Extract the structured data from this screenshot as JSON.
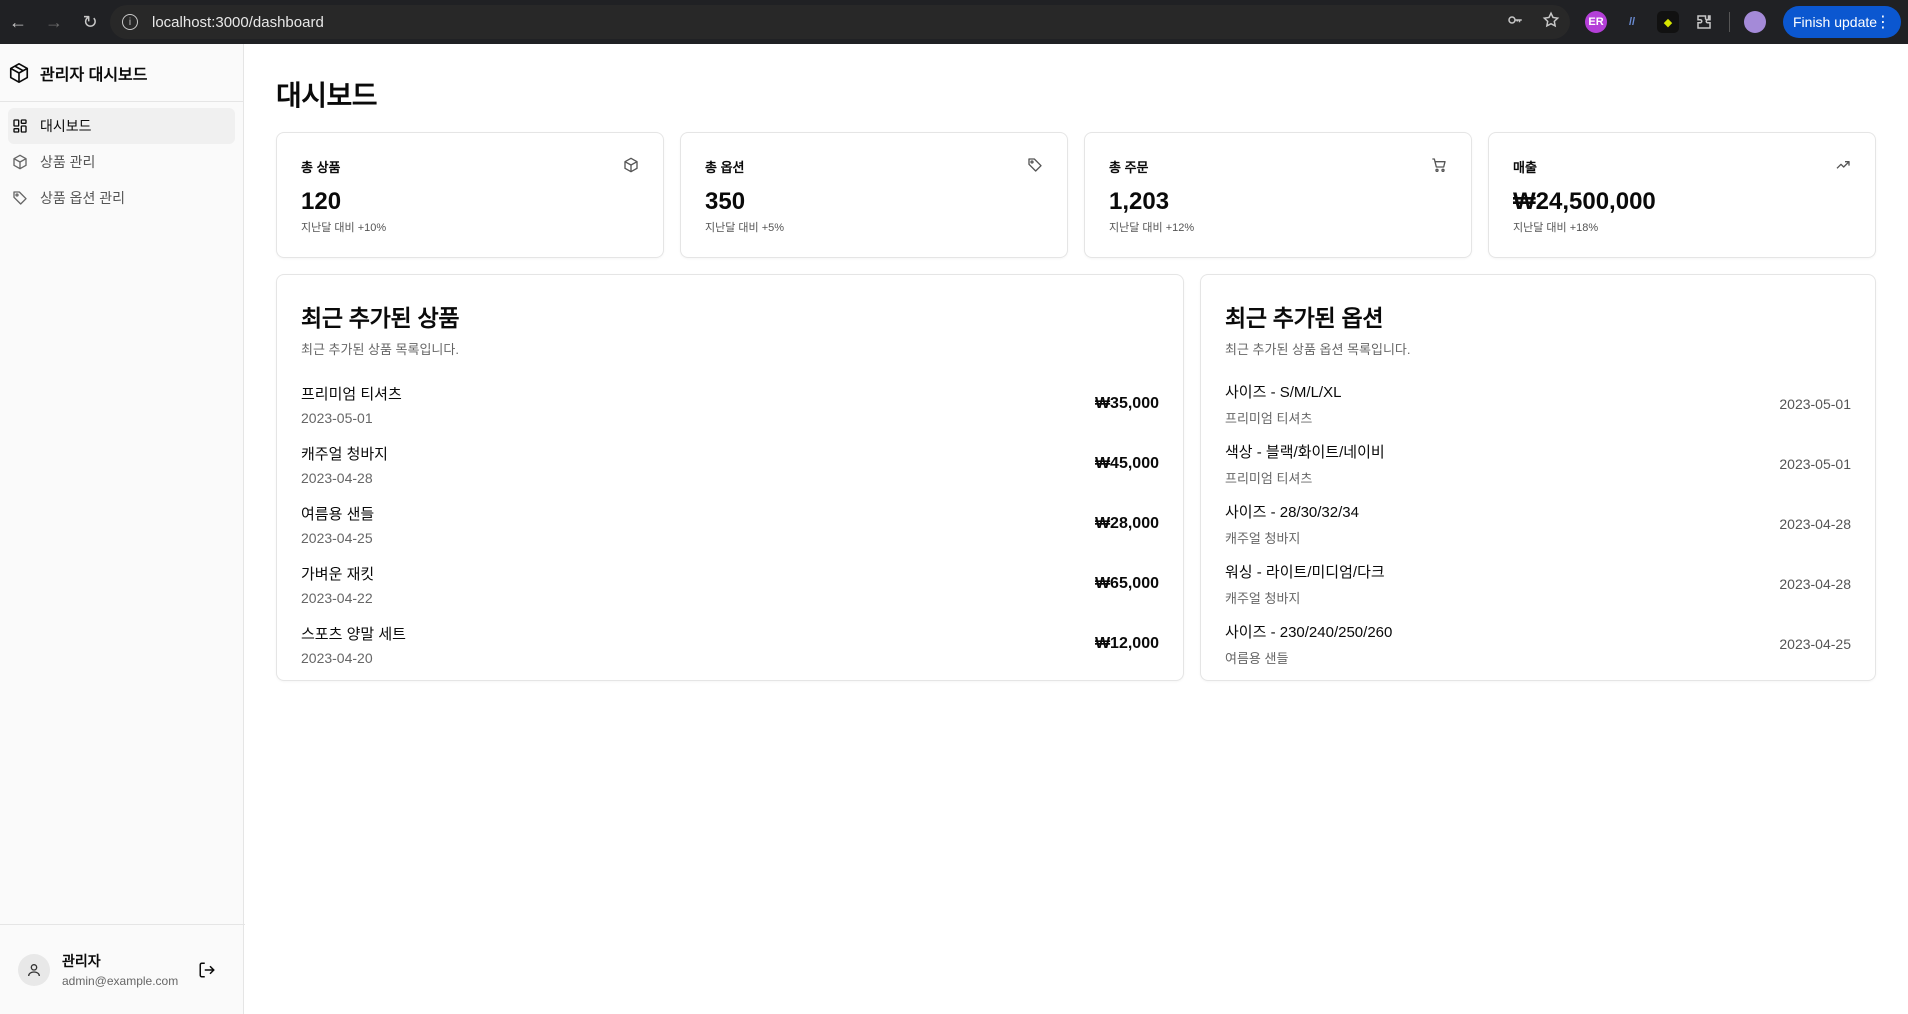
{
  "browser": {
    "url": "localhost:3000/dashboard",
    "finish_update": "Finish update"
  },
  "sidebar": {
    "brand": "관리자 대시보드",
    "items": [
      {
        "label": "대시보드",
        "icon": "grid-icon",
        "active": true
      },
      {
        "label": "상품 관리",
        "icon": "package-icon",
        "active": false
      },
      {
        "label": "상품 옵션 관리",
        "icon": "tag-icon",
        "active": false
      }
    ],
    "user": {
      "name": "관리자",
      "email": "admin@example.com"
    }
  },
  "main": {
    "title": "대시보드",
    "stats": [
      {
        "label": "총 상품",
        "value": "120",
        "change": "지난달 대비 +10%",
        "icon": "package-icon"
      },
      {
        "label": "총 옵션",
        "value": "350",
        "change": "지난달 대비 +5%",
        "icon": "tag-icon"
      },
      {
        "label": "총 주문",
        "value": "1,203",
        "change": "지난달 대비 +12%",
        "icon": "cart-icon"
      },
      {
        "label": "매출",
        "value": "₩24,500,000",
        "change": "지난달 대비 +18%",
        "icon": "trending-up-icon"
      }
    ],
    "recent_products": {
      "title": "최근 추가된 상품",
      "description": "최근 추가된 상품 목록입니다.",
      "items": [
        {
          "name": "프리미엄 티셔츠",
          "date": "2023-05-01",
          "price": "₩35,000"
        },
        {
          "name": "캐주얼 청바지",
          "date": "2023-04-28",
          "price": "₩45,000"
        },
        {
          "name": "여름용 샌들",
          "date": "2023-04-25",
          "price": "₩28,000"
        },
        {
          "name": "가벼운 재킷",
          "date": "2023-04-22",
          "price": "₩65,000"
        },
        {
          "name": "스포츠 양말 세트",
          "date": "2023-04-20",
          "price": "₩12,000"
        }
      ]
    },
    "recent_options": {
      "title": "최근 추가된 옵션",
      "description": "최근 추가된 상품 옵션 목록입니다.",
      "items": [
        {
          "name": "사이즈 - S/M/L/XL",
          "product": "프리미엄 티셔츠",
          "date": "2023-05-01"
        },
        {
          "name": "색상 - 블랙/화이트/네이비",
          "product": "프리미엄 티셔츠",
          "date": "2023-05-01"
        },
        {
          "name": "사이즈 - 28/30/32/34",
          "product": "캐주얼 청바지",
          "date": "2023-04-28"
        },
        {
          "name": "워싱 - 라이트/미디엄/다크",
          "product": "캐주얼 청바지",
          "date": "2023-04-28"
        },
        {
          "name": "사이즈 - 230/240/250/260",
          "product": "여름용 샌들",
          "date": "2023-04-25"
        }
      ]
    }
  }
}
